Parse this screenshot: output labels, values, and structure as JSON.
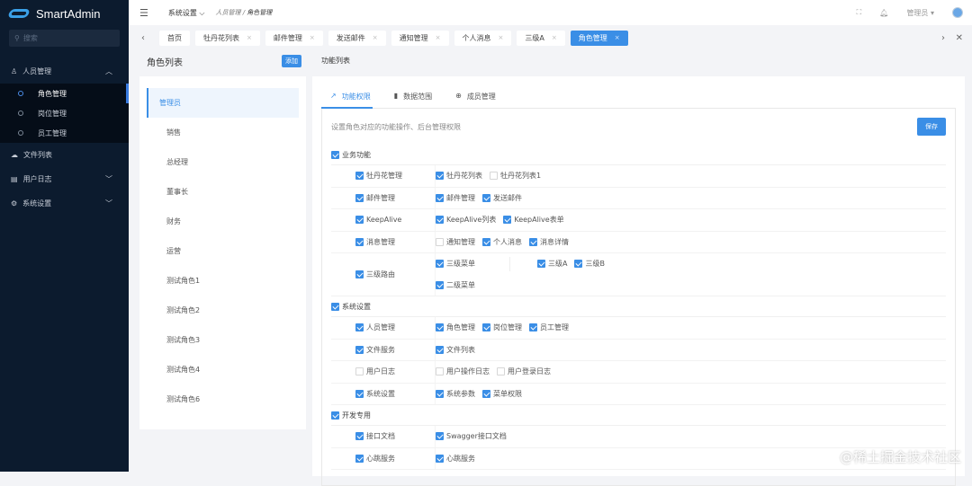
{
  "app": {
    "name": "SmartAdmin",
    "search_placeholder": "搜索"
  },
  "sidebar": {
    "items": [
      {
        "label": "人员管理",
        "icon": "user-icon",
        "expanded": true,
        "children": [
          {
            "label": "角色管理",
            "active": true
          },
          {
            "label": "岗位管理"
          },
          {
            "label": "员工管理"
          }
        ]
      },
      {
        "label": "文件列表",
        "icon": "cloud-icon"
      },
      {
        "label": "用户日志",
        "icon": "log-icon"
      },
      {
        "label": "系统设置",
        "icon": "gear-icon"
      }
    ]
  },
  "header": {
    "menu": "系统设置",
    "breadcrumb": [
      "人员管理",
      "角色管理"
    ],
    "user": "管理员"
  },
  "tabs": [
    {
      "label": "首页"
    },
    {
      "label": "牡丹花列表"
    },
    {
      "label": "邮件管理"
    },
    {
      "label": "发送邮件"
    },
    {
      "label": "通知管理"
    },
    {
      "label": "个人消息"
    },
    {
      "label": "三级A"
    },
    {
      "label": "角色管理",
      "active": true
    }
  ],
  "roles": {
    "title": "角色列表",
    "add": "添加",
    "items": [
      "管理员",
      "销售",
      "总经理",
      "董事长",
      "财务",
      "运营",
      "测试角色1",
      "测试角色2",
      "测试角色3",
      "测试角色4",
      "测试角色6"
    ],
    "active": 0
  },
  "perm": {
    "title": "功能列表",
    "tabs": [
      "功能权限",
      "数据范围",
      "成员管理"
    ],
    "desc": "设置角色对应的功能操作、后台管理权限",
    "save": "保存",
    "groups": [
      {
        "label": "业务功能",
        "checked": true,
        "rows": [
          {
            "label": "牡丹花管理",
            "checked": true,
            "items": [
              {
                "label": "牡丹花列表",
                "checked": true
              },
              {
                "label": "牡丹花列表1",
                "checked": false
              }
            ]
          },
          {
            "label": "邮件管理",
            "checked": true,
            "items": [
              {
                "label": "邮件管理",
                "checked": true
              },
              {
                "label": "发送邮件",
                "checked": true
              }
            ]
          },
          {
            "label": "KeepAlive",
            "checked": true,
            "items": [
              {
                "label": "KeepAlive列表",
                "checked": true
              },
              {
                "label": "KeepAlive表单",
                "checked": true
              }
            ]
          },
          {
            "label": "消息管理",
            "checked": true,
            "items": [
              {
                "label": "通知管理",
                "checked": false
              },
              {
                "label": "个人消息",
                "checked": true
              },
              {
                "label": "消息详情",
                "checked": true
              }
            ]
          },
          {
            "label": "三级路由",
            "checked": true,
            "nested": [
              {
                "label": "三级菜单",
                "checked": true,
                "items": [
                  {
                    "label": "三级A",
                    "checked": true
                  },
                  {
                    "label": "三级B",
                    "checked": true
                  }
                ]
              },
              {
                "label": "二级菜单",
                "checked": true,
                "items": []
              }
            ]
          }
        ]
      },
      {
        "label": "系统设置",
        "checked": true,
        "rows": [
          {
            "label": "人员管理",
            "checked": true,
            "items": [
              {
                "label": "角色管理",
                "checked": true
              },
              {
                "label": "岗位管理",
                "checked": true
              },
              {
                "label": "员工管理",
                "checked": true
              }
            ]
          },
          {
            "label": "文件服务",
            "checked": true,
            "items": [
              {
                "label": "文件列表",
                "checked": true
              }
            ]
          },
          {
            "label": "用户日志",
            "checked": false,
            "items": [
              {
                "label": "用户操作日志",
                "checked": false
              },
              {
                "label": "用户登录日志",
                "checked": false
              }
            ]
          },
          {
            "label": "系统设置",
            "checked": true,
            "items": [
              {
                "label": "系统参数",
                "checked": true
              },
              {
                "label": "菜单权限",
                "checked": true
              }
            ]
          }
        ]
      },
      {
        "label": "开发专用",
        "checked": true,
        "rows": [
          {
            "label": "接口文档",
            "checked": true,
            "items": [
              {
                "label": "Swagger接口文档",
                "checked": true
              }
            ]
          },
          {
            "label": "心跳服务",
            "checked": true,
            "items": [
              {
                "label": "心跳服务",
                "checked": true
              }
            ]
          }
        ]
      }
    ]
  },
  "watermark": "@稀土掘金技术社区",
  "colors": {
    "accent": "#3a8ee6",
    "sidebar": "#0c1b2e"
  }
}
